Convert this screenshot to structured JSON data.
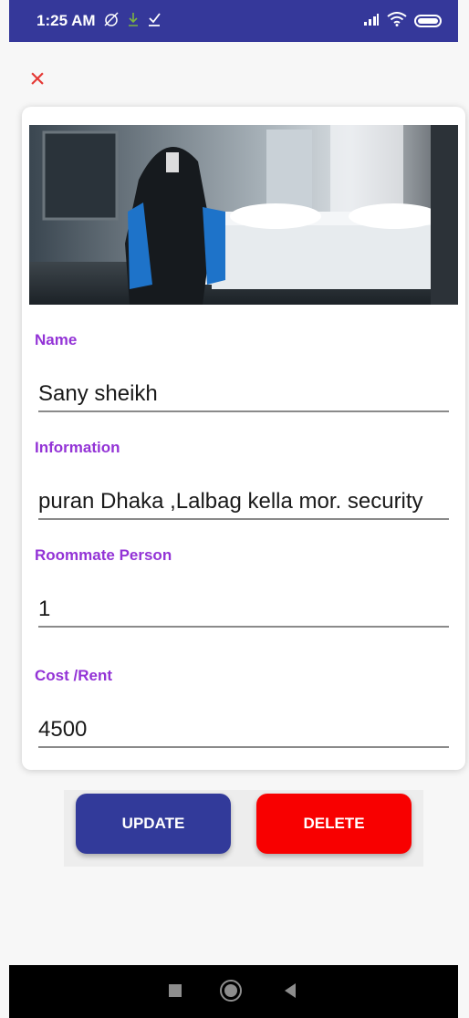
{
  "status_bar": {
    "time": "1:25 AM",
    "icons": [
      "alarm-off-icon",
      "download-icon",
      "download-done-icon",
      "signal-icon",
      "wifi-icon",
      "battery-icon"
    ]
  },
  "close_icon": "×",
  "form": {
    "photo_icon": "room-photo",
    "name_label": "Name",
    "name_value": "Sany sheikh",
    "information_label": "Information",
    "information_value": "puran Dhaka ,Lalbag kella mor. security",
    "roommate_label": "Roommate Person",
    "roommate_value": "1",
    "cost_label": "Cost /Rent",
    "cost_value": "4500"
  },
  "actions": {
    "update_label": "UPDATE",
    "delete_label": "DELETE"
  },
  "colors": {
    "status_bar": "#35389a",
    "label": "#9333d6",
    "update_button": "#323a9a",
    "delete_button": "#f80000",
    "close_icon": "#e53935"
  },
  "nav": {
    "buttons": [
      "recent-apps-icon",
      "home-icon",
      "back-icon"
    ]
  }
}
